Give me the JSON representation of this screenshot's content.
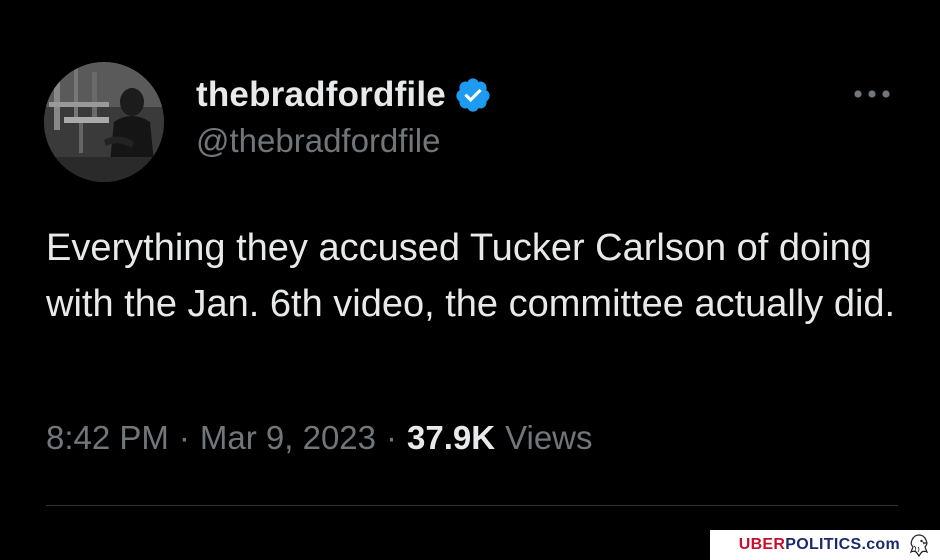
{
  "tweet": {
    "display_name": "thebradfordfile",
    "handle": "@thebradfordfile",
    "text": "Everything they accused Tucker Carlson of doing with the Jan. 6th video, the committee actually did.",
    "time": "8:42 PM",
    "separator": "·",
    "date": "Mar 9, 2023",
    "views_count": "37.9K",
    "views_label": "Views"
  },
  "icons": {
    "avatar": "avatar-photo",
    "verified": "verified-badge-icon",
    "more": "more-options-icon",
    "watermark_logo": "eagle-icon"
  },
  "watermark": {
    "part1": "UBER",
    "part2": "POLITICS",
    "part3": ".com"
  },
  "colors": {
    "background": "#000000",
    "primary_text": "#e7e9ea",
    "secondary_text": "#71767b",
    "verified_blue": "#1d9bf0",
    "divider": "#2f3336",
    "watermark_red": "#c8102e",
    "watermark_navy": "#1a2a6c"
  }
}
